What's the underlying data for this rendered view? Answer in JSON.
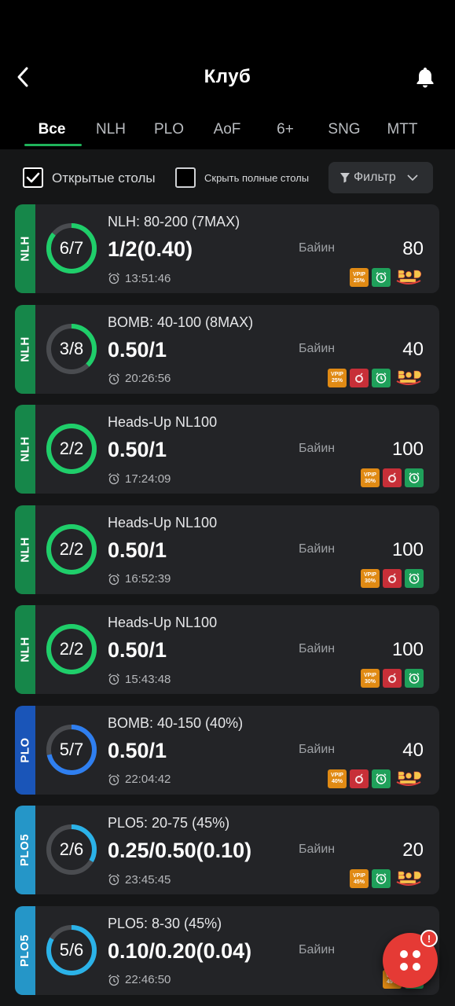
{
  "header": {
    "title": "Клуб"
  },
  "tabs": [
    {
      "label": "Все",
      "active": true
    },
    {
      "label": "NLH"
    },
    {
      "label": "PLO"
    },
    {
      "label": "AoF"
    },
    {
      "label": "6+"
    },
    {
      "label": "SNG"
    },
    {
      "label": "MTT"
    }
  ],
  "filters": {
    "open_tables_label": "Открытые столы",
    "open_tables_checked": true,
    "hide_full_label": "Скрыть полные столы",
    "hide_full_checked": false,
    "filter_button_label": "Фильтр"
  },
  "colors": {
    "accent": "#1fb35a",
    "nlh": "#16874a",
    "plo": "#1a55b8",
    "plo5": "#2596c8"
  },
  "buyin_label": "Байин",
  "tables": [
    {
      "game": "NLH",
      "seats": "6/7",
      "fill": 0.857,
      "name": "NLH: 80-200 (7MAX)",
      "stakes": "1/2(0.40)",
      "time": "13:51:46",
      "buyin": "80",
      "badges": [
        "vpip",
        "clock",
        "badbeat"
      ],
      "vpip": "25%"
    },
    {
      "game": "NLH",
      "seats": "3/8",
      "fill": 0.375,
      "name": "BOMB: 40-100 (8MAX)",
      "stakes": "0.50/1",
      "time": "20:26:56",
      "buyin": "40",
      "badges": [
        "vpip",
        "bomb",
        "clock",
        "badbeat"
      ],
      "vpip": "25%"
    },
    {
      "game": "NLH",
      "seats": "2/2",
      "fill": 1,
      "name": "Heads-Up NL100",
      "stakes": "0.50/1",
      "time": "17:24:09",
      "buyin": "100",
      "badges": [
        "vpip",
        "bomb",
        "clock"
      ],
      "vpip": "30%"
    },
    {
      "game": "NLH",
      "seats": "2/2",
      "fill": 1,
      "name": "Heads-Up NL100",
      "stakes": "0.50/1",
      "time": "16:52:39",
      "buyin": "100",
      "badges": [
        "vpip",
        "bomb",
        "clock"
      ],
      "vpip": "30%"
    },
    {
      "game": "NLH",
      "seats": "2/2",
      "fill": 1,
      "name": "Heads-Up NL100",
      "stakes": "0.50/1",
      "time": "15:43:48",
      "buyin": "100",
      "badges": [
        "vpip",
        "bomb",
        "clock"
      ],
      "vpip": "30%"
    },
    {
      "game": "PLO",
      "seats": "5/7",
      "fill": 0.714,
      "name": "BOMB: 40-150 (40%)",
      "stakes": "0.50/1",
      "time": "22:04:42",
      "buyin": "40",
      "badges": [
        "vpip",
        "bomb",
        "clock",
        "badbeat"
      ],
      "vpip": "40%"
    },
    {
      "game": "PLO5",
      "seats": "2/6",
      "fill": 0.333,
      "name": "PLO5: 20-75 (45%)",
      "stakes": "0.25/0.50(0.10)",
      "time": "23:45:45",
      "buyin": "20",
      "badges": [
        "vpip",
        "clock",
        "badbeat"
      ],
      "vpip": "45%"
    },
    {
      "game": "PLO5",
      "seats": "5/6",
      "fill": 0.833,
      "name": "PLO5: 8-30 (45%)",
      "stakes": "0.10/0.20(0.04)",
      "time": "22:46:50",
      "buyin": "",
      "badges": [
        "vpip",
        "clock"
      ],
      "vpip": "45%"
    }
  ],
  "fab_badge": "!"
}
